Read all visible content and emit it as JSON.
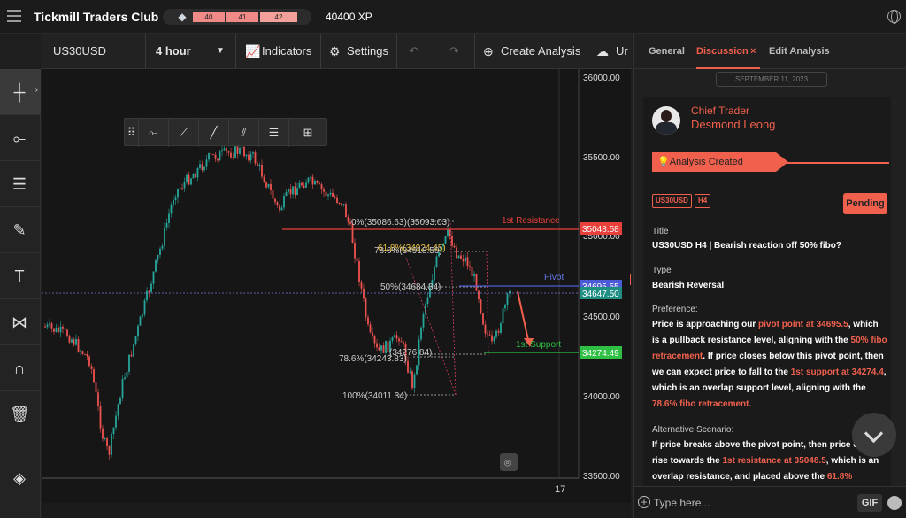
{
  "app": {
    "title": "Tickmill Traders Club",
    "xp_levels": [
      "40",
      "41",
      "42"
    ],
    "xp": "40400 XP"
  },
  "toolbar": {
    "symbol": "US30USD",
    "interval": "4 hour",
    "indicators": "Indicators",
    "settings": "Settings",
    "create_analysis": "Create Analysis",
    "cut_label": "Ur"
  },
  "chart": {
    "price_labels": [
      "36000.00",
      "35500.00",
      "35000.00",
      "34500.00",
      "34000.00",
      "33500.00"
    ],
    "date_label": "17",
    "levels": {
      "resistance": {
        "label": "1st Resistance",
        "value": "35048.58",
        "color": "#e8403a"
      },
      "pivot": {
        "label": "Pivot",
        "value": "34695.55",
        "color": "#4b5bd6"
      },
      "current": {
        "value": "34647.50",
        "color": "#26a69a"
      },
      "support": {
        "label": "1st Support",
        "value": "34274.49",
        "color": "#2fbf44"
      }
    },
    "fib": [
      "0%(35086.63)",
      "(35093.03)",
      "61.8%(34924.45)",
      "78.6%(34918.59)",
      "50%(34684.84)",
      "78.6%(34243.83)",
      "(34276.84)",
      "100%(34011.34)"
    ]
  },
  "panel": {
    "tabs": [
      "General",
      "Discussion",
      "Edit Analysis"
    ],
    "date": "SEPTEMBER 11, 2023",
    "role": "Chief Trader",
    "name": "Desmond Leong",
    "created": "Analysis Created",
    "tags": [
      "US30USD",
      "H4"
    ],
    "status": "Pending",
    "title_label": "Title",
    "title": "US30USD H4 | Bearish reaction off 50% fibo?",
    "type_label": "Type",
    "type": "Bearish Reversal",
    "preference_label": "Preference:",
    "alt_label": "Alternative Scenario:",
    "input_placeholder": "Type here...",
    "gif": "GIF"
  },
  "colors": {
    "accent": "#f0604d",
    "up": "#26a69a",
    "down": "#ef5350"
  }
}
